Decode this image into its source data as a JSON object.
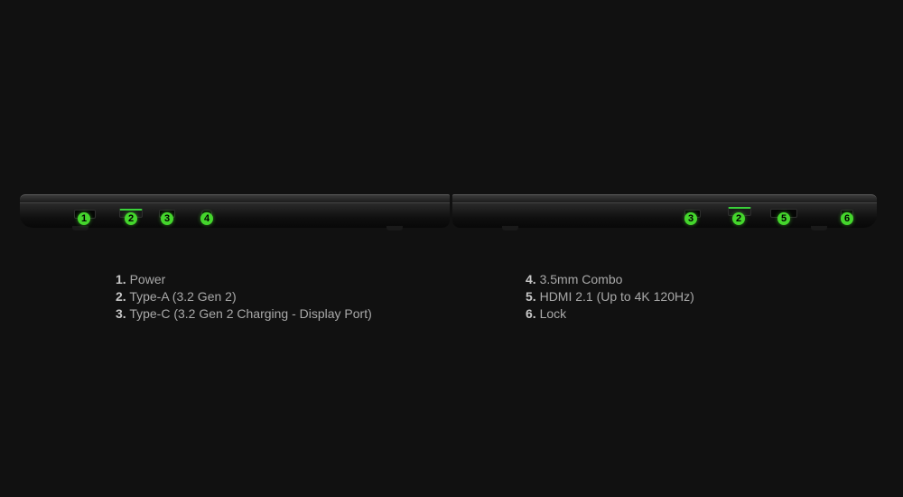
{
  "colors": {
    "background": "#111111",
    "accent": "#44d62c",
    "legend_text": "#a9a9a9"
  },
  "left_side": {
    "badges": [
      "1",
      "2",
      "3",
      "4"
    ]
  },
  "right_side": {
    "badges": [
      "3",
      "2",
      "5",
      "6"
    ]
  },
  "legend": {
    "column1": [
      {
        "num": "1.",
        "label": "Power"
      },
      {
        "num": "2.",
        "label": "Type-A (3.2 Gen 2)"
      },
      {
        "num": "3.",
        "label": "Type-C (3.2 Gen 2 Charging - Display Port)"
      }
    ],
    "column2": [
      {
        "num": "4.",
        "label": "3.5mm Combo"
      },
      {
        "num": "5.",
        "label": "HDMI 2.1 (Up to 4K 120Hz)"
      },
      {
        "num": "6.",
        "label": "Lock"
      }
    ]
  }
}
